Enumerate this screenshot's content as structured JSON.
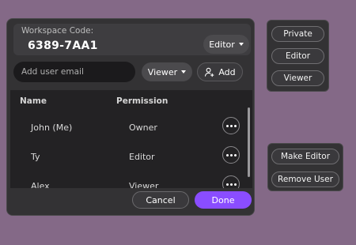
{
  "dialog": {
    "workspace_label": "Workspace Code:",
    "workspace_code": "6389-7AA1",
    "role_selector": "Editor",
    "email_placeholder": "Add user email",
    "permission_selector": "Viewer",
    "add_label": "Add",
    "table": {
      "headers": {
        "name": "Name",
        "permission": "Permission"
      },
      "rows": [
        {
          "name": "John (Me)",
          "permission": "Owner"
        },
        {
          "name": "Ty",
          "permission": "Editor"
        },
        {
          "name": "Alex",
          "permission": "Viewer"
        }
      ]
    },
    "cancel_label": "Cancel",
    "done_label": "Done"
  },
  "role_menu": {
    "items": [
      "Private",
      "Editor",
      "Viewer"
    ]
  },
  "user_actions_menu": {
    "items": [
      "Make Editor",
      "Remove User"
    ]
  },
  "colors": {
    "background": "#846987",
    "panel": "#333234",
    "accent": "#8a4dff"
  }
}
